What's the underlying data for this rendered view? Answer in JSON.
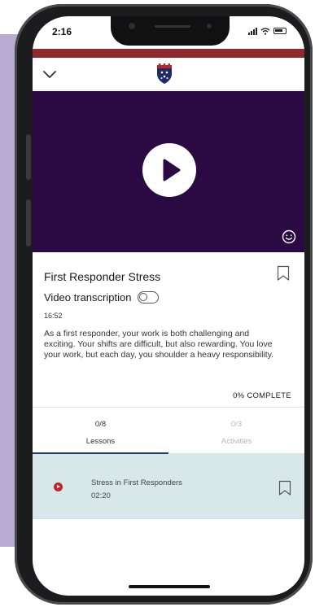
{
  "status_bar": {
    "time": "2:16",
    "location_icon": "location-arrow-icon",
    "signal_icon": "cellular-signal-icon",
    "wifi_icon": "wifi-icon",
    "battery_icon": "battery-icon"
  },
  "header": {
    "collapse_icon": "chevron-down-icon",
    "logo_icon": "crest-logo-icon"
  },
  "video": {
    "play_icon": "play-icon",
    "accessibility_icon": "face-smile-icon",
    "background_color": "#2b0a44"
  },
  "lesson": {
    "title": "First Responder Stress",
    "transcription_label": "Video transcription",
    "transcription_enabled": false,
    "duration": "16:52",
    "description": "As a first responder, your work is both challenging and exciting. Your shifts are difficult, but also rewarding. You love your work, but each day, you shoulder a heavy responsibility.",
    "progress_text": "0% COMPLETE",
    "progress_percent": 0
  },
  "tabs": [
    {
      "count": "0/8",
      "label": "Lessons",
      "active": true
    },
    {
      "count": "0/3",
      "label": "Activities",
      "active": false
    }
  ],
  "lessons": [
    {
      "name": "Stress in First Responders",
      "time": "02:20"
    }
  ],
  "colors": {
    "brand_red": "#8f2b2e",
    "video_purple": "#2b0a44",
    "active_tab": "#1f3b6e",
    "row_highlight": "#d7e7ea",
    "play_dot": "#c4252a",
    "backdrop": "#b9acd3"
  }
}
